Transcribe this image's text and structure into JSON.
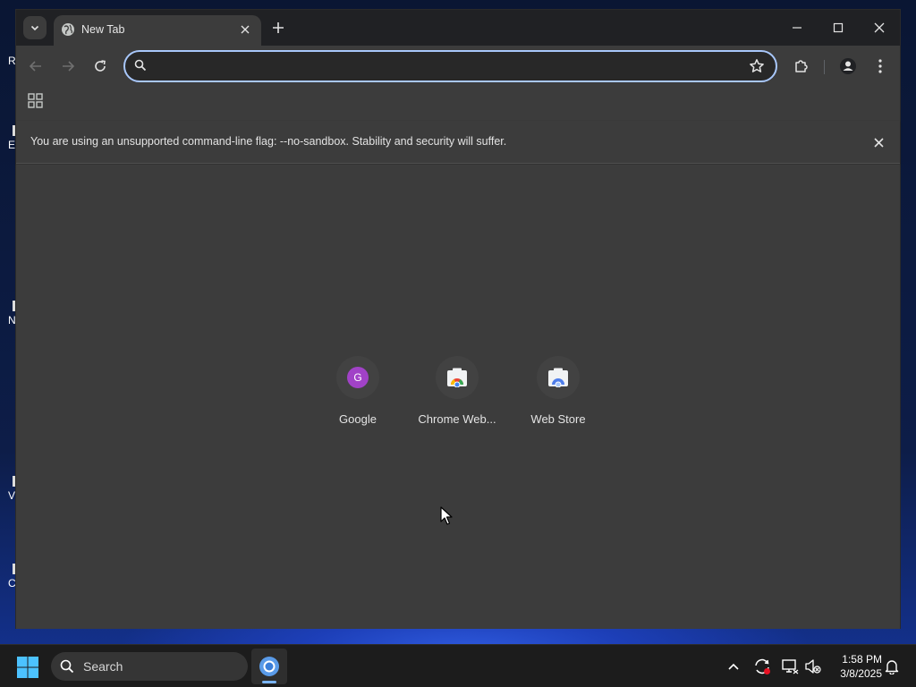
{
  "desktop": {
    "icons": [
      {
        "label": "R"
      },
      {
        "label": "E"
      },
      {
        "label": "N"
      },
      {
        "label": "V"
      },
      {
        "label": "C"
      }
    ]
  },
  "browser": {
    "tab": {
      "title": "New Tab",
      "favicon": "globe-icon"
    },
    "omnibox": {
      "value": "",
      "placeholder": ""
    },
    "infobar": {
      "message": "You are using an unsupported command-line flag: --no-sandbox. Stability and security will suffer."
    },
    "shortcuts": [
      {
        "label": "Google",
        "icon": "google-letter-icon",
        "letter": "G"
      },
      {
        "label": "Chrome Web...",
        "icon": "chrome-web-store-icon"
      },
      {
        "label": "Web Store",
        "icon": "web-store-icon"
      }
    ],
    "colors": {
      "accent": "#a8c7fa",
      "google_circle": "#a142c7",
      "frame": "#202124",
      "surface": "#3c3c3c"
    }
  },
  "taskbar": {
    "search_label": "Search",
    "time": "1:58 PM",
    "date": "3/8/2025"
  }
}
